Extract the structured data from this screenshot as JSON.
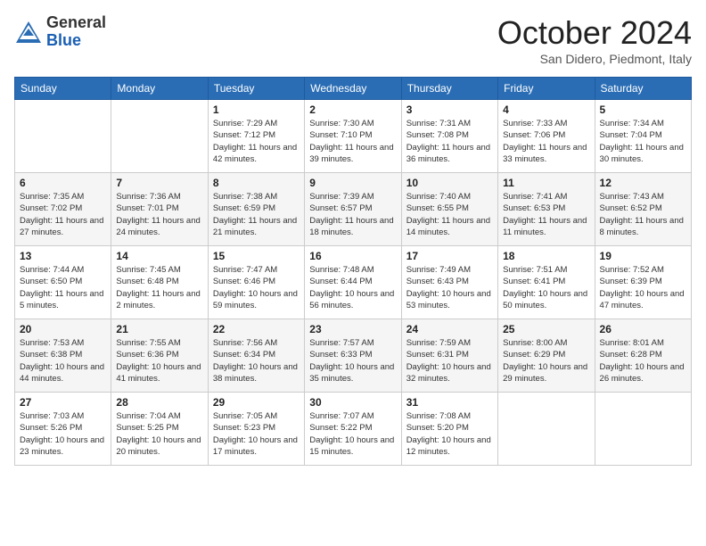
{
  "logo": {
    "general": "General",
    "blue": "Blue"
  },
  "title": "October 2024",
  "location": "San Didero, Piedmont, Italy",
  "headers": [
    "Sunday",
    "Monday",
    "Tuesday",
    "Wednesday",
    "Thursday",
    "Friday",
    "Saturday"
  ],
  "weeks": [
    [
      {
        "day": "",
        "info": ""
      },
      {
        "day": "",
        "info": ""
      },
      {
        "day": "1",
        "info": "Sunrise: 7:29 AM\nSunset: 7:12 PM\nDaylight: 11 hours and 42 minutes."
      },
      {
        "day": "2",
        "info": "Sunrise: 7:30 AM\nSunset: 7:10 PM\nDaylight: 11 hours and 39 minutes."
      },
      {
        "day": "3",
        "info": "Sunrise: 7:31 AM\nSunset: 7:08 PM\nDaylight: 11 hours and 36 minutes."
      },
      {
        "day": "4",
        "info": "Sunrise: 7:33 AM\nSunset: 7:06 PM\nDaylight: 11 hours and 33 minutes."
      },
      {
        "day": "5",
        "info": "Sunrise: 7:34 AM\nSunset: 7:04 PM\nDaylight: 11 hours and 30 minutes."
      }
    ],
    [
      {
        "day": "6",
        "info": "Sunrise: 7:35 AM\nSunset: 7:02 PM\nDaylight: 11 hours and 27 minutes."
      },
      {
        "day": "7",
        "info": "Sunrise: 7:36 AM\nSunset: 7:01 PM\nDaylight: 11 hours and 24 minutes."
      },
      {
        "day": "8",
        "info": "Sunrise: 7:38 AM\nSunset: 6:59 PM\nDaylight: 11 hours and 21 minutes."
      },
      {
        "day": "9",
        "info": "Sunrise: 7:39 AM\nSunset: 6:57 PM\nDaylight: 11 hours and 18 minutes."
      },
      {
        "day": "10",
        "info": "Sunrise: 7:40 AM\nSunset: 6:55 PM\nDaylight: 11 hours and 14 minutes."
      },
      {
        "day": "11",
        "info": "Sunrise: 7:41 AM\nSunset: 6:53 PM\nDaylight: 11 hours and 11 minutes."
      },
      {
        "day": "12",
        "info": "Sunrise: 7:43 AM\nSunset: 6:52 PM\nDaylight: 11 hours and 8 minutes."
      }
    ],
    [
      {
        "day": "13",
        "info": "Sunrise: 7:44 AM\nSunset: 6:50 PM\nDaylight: 11 hours and 5 minutes."
      },
      {
        "day": "14",
        "info": "Sunrise: 7:45 AM\nSunset: 6:48 PM\nDaylight: 11 hours and 2 minutes."
      },
      {
        "day": "15",
        "info": "Sunrise: 7:47 AM\nSunset: 6:46 PM\nDaylight: 10 hours and 59 minutes."
      },
      {
        "day": "16",
        "info": "Sunrise: 7:48 AM\nSunset: 6:44 PM\nDaylight: 10 hours and 56 minutes."
      },
      {
        "day": "17",
        "info": "Sunrise: 7:49 AM\nSunset: 6:43 PM\nDaylight: 10 hours and 53 minutes."
      },
      {
        "day": "18",
        "info": "Sunrise: 7:51 AM\nSunset: 6:41 PM\nDaylight: 10 hours and 50 minutes."
      },
      {
        "day": "19",
        "info": "Sunrise: 7:52 AM\nSunset: 6:39 PM\nDaylight: 10 hours and 47 minutes."
      }
    ],
    [
      {
        "day": "20",
        "info": "Sunrise: 7:53 AM\nSunset: 6:38 PM\nDaylight: 10 hours and 44 minutes."
      },
      {
        "day": "21",
        "info": "Sunrise: 7:55 AM\nSunset: 6:36 PM\nDaylight: 10 hours and 41 minutes."
      },
      {
        "day": "22",
        "info": "Sunrise: 7:56 AM\nSunset: 6:34 PM\nDaylight: 10 hours and 38 minutes."
      },
      {
        "day": "23",
        "info": "Sunrise: 7:57 AM\nSunset: 6:33 PM\nDaylight: 10 hours and 35 minutes."
      },
      {
        "day": "24",
        "info": "Sunrise: 7:59 AM\nSunset: 6:31 PM\nDaylight: 10 hours and 32 minutes."
      },
      {
        "day": "25",
        "info": "Sunrise: 8:00 AM\nSunset: 6:29 PM\nDaylight: 10 hours and 29 minutes."
      },
      {
        "day": "26",
        "info": "Sunrise: 8:01 AM\nSunset: 6:28 PM\nDaylight: 10 hours and 26 minutes."
      }
    ],
    [
      {
        "day": "27",
        "info": "Sunrise: 7:03 AM\nSunset: 5:26 PM\nDaylight: 10 hours and 23 minutes."
      },
      {
        "day": "28",
        "info": "Sunrise: 7:04 AM\nSunset: 5:25 PM\nDaylight: 10 hours and 20 minutes."
      },
      {
        "day": "29",
        "info": "Sunrise: 7:05 AM\nSunset: 5:23 PM\nDaylight: 10 hours and 17 minutes."
      },
      {
        "day": "30",
        "info": "Sunrise: 7:07 AM\nSunset: 5:22 PM\nDaylight: 10 hours and 15 minutes."
      },
      {
        "day": "31",
        "info": "Sunrise: 7:08 AM\nSunset: 5:20 PM\nDaylight: 10 hours and 12 minutes."
      },
      {
        "day": "",
        "info": ""
      },
      {
        "day": "",
        "info": ""
      }
    ]
  ]
}
